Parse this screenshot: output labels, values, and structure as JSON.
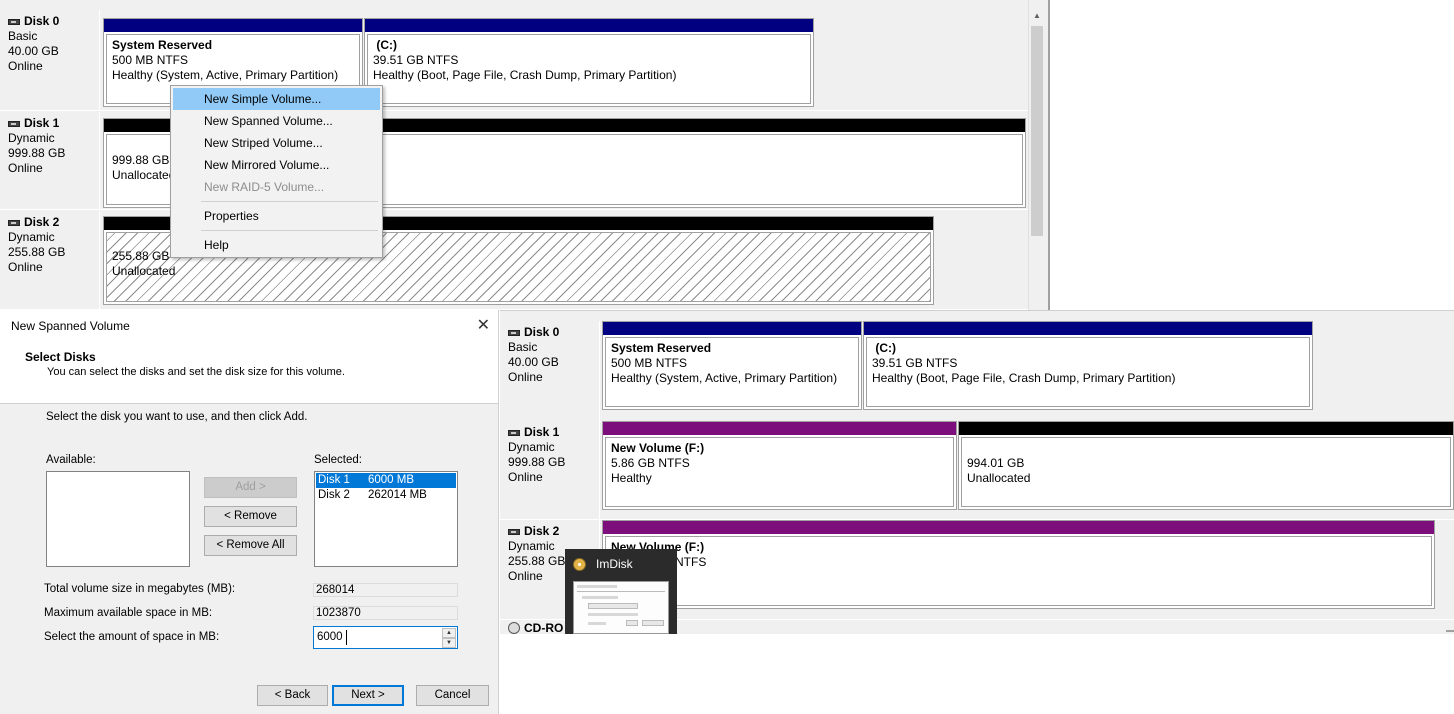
{
  "top_panel": {
    "disks": [
      {
        "name": "Disk 0",
        "type": "Basic",
        "size": "40.00 GB",
        "status": "Online",
        "volumes": [
          {
            "title": "System Reserved",
            "line2": "500 MB NTFS",
            "line3": "Healthy (System, Active, Primary Partition)"
          },
          {
            "title": "(C:)",
            "line2": "39.51 GB NTFS",
            "line3": "Healthy (Boot, Page File, Crash Dump, Primary Partition)"
          }
        ]
      },
      {
        "name": "Disk 1",
        "type": "Dynamic",
        "size": "999.88 GB",
        "status": "Online",
        "volumes": [
          {
            "line1": "999.88 GB",
            "line2": "Unallocated"
          }
        ]
      },
      {
        "name": "Disk 2",
        "type": "Dynamic",
        "size": "255.88 GB",
        "status": "Online",
        "volumes": [
          {
            "line1": "255.88 GB",
            "line2": "Unallocated"
          }
        ]
      }
    ]
  },
  "context_menu": {
    "items": [
      {
        "label": "New Simple Volume...",
        "state": "highlighted"
      },
      {
        "label": "New Spanned Volume...",
        "state": "enabled"
      },
      {
        "label": "New Striped Volume...",
        "state": "enabled"
      },
      {
        "label": "New Mirrored Volume...",
        "state": "enabled"
      },
      {
        "label": "New RAID-5 Volume...",
        "state": "disabled"
      },
      {
        "label": "Properties",
        "state": "enabled"
      },
      {
        "label": "Help",
        "state": "enabled"
      }
    ]
  },
  "wizard": {
    "title": "New Spanned Volume",
    "close_glyph": "✕",
    "header_title": "Select Disks",
    "header_subtitle": "You can select the disks and set the disk size for this volume.",
    "instruction": "Select the disk you want to use, and then click Add.",
    "available_label": "Available:",
    "selected_label": "Selected:",
    "selected_disks": [
      {
        "disk": "Disk 1",
        "size": "6000 MB",
        "selected": true
      },
      {
        "disk": "Disk 2",
        "size": "262014 MB",
        "selected": false
      }
    ],
    "add_button": "Add >",
    "remove_button": "< Remove",
    "remove_all_button": "< Remove All",
    "total_label": "Total volume size in megabytes (MB):",
    "total_value": "268014",
    "max_label": "Maximum available space in MB:",
    "max_value": "1023870",
    "amount_label": "Select the amount of space in MB:",
    "amount_value": "6000",
    "back_button": "< Back",
    "next_button": "Next >",
    "cancel_button": "Cancel"
  },
  "bottom_panel": {
    "disks": [
      {
        "name": "Disk 0",
        "type": "Basic",
        "size": "40.00 GB",
        "status": "Online",
        "volumes": [
          {
            "title": "System Reserved",
            "line2": "500 MB NTFS",
            "line3": "Healthy (System, Active, Primary Partition)"
          },
          {
            "title": "(C:)",
            "line2": "39.51 GB NTFS",
            "line3": "Healthy (Boot, Page File, Crash Dump, Primary Partition)"
          }
        ]
      },
      {
        "name": "Disk 1",
        "type": "Dynamic",
        "size": "999.88 GB",
        "status": "Online",
        "volumes": [
          {
            "title": "New Volume  (F:)",
            "line2": "5.86 GB NTFS",
            "line3": "Healthy"
          },
          {
            "line1": "994.01 GB",
            "line2": "Unallocated"
          }
        ]
      },
      {
        "name": "Disk 2",
        "type": "Dynamic",
        "size": "255.88 GB",
        "status": "Online",
        "volumes": [
          {
            "title": "New Volume  (F:)",
            "line2": "NTFS"
          }
        ]
      },
      {
        "name": "CD-RO"
      }
    ]
  },
  "imdisk_popup": {
    "title": "ImDisk"
  },
  "colors": {
    "basic_bar": "#000080",
    "unallocated_bar": "#000000",
    "spanned_bar": "#7d0f7d",
    "menu_highlight": "#91c9f7",
    "selection": "#0078d7"
  }
}
